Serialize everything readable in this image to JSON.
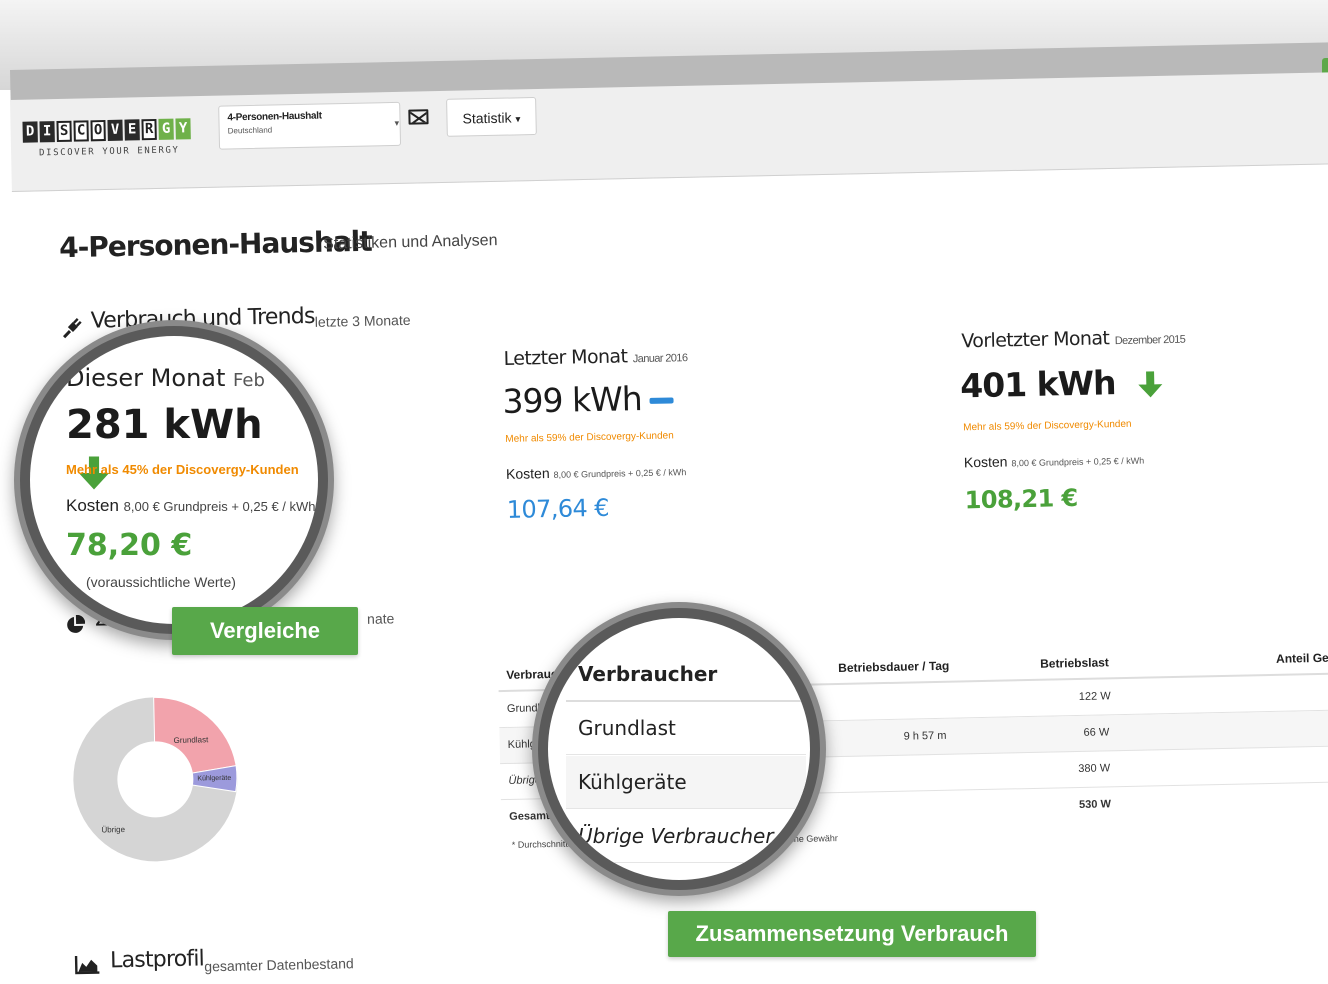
{
  "header": {
    "logo_letters": [
      "D",
      "I",
      "S",
      "C",
      "O",
      "V",
      "E",
      "R",
      "G",
      "Y"
    ],
    "logo_tagline": "DISCOVER YOUR ENERGY",
    "meter_name": "4-Personen-Haushalt",
    "meter_country": "Deutschland",
    "statistik_label": "Statistik",
    "icons": [
      "mail-icon",
      "caret-down-icon"
    ]
  },
  "page": {
    "title": "4-Personen-Haushalt",
    "subtitle": "Statistiken und Analysen"
  },
  "verbrauch": {
    "heading": "Verbrauch und Trends",
    "sub": "letzte 3 Monate",
    "icon": "plug-icon",
    "this_month": {
      "title": "Dieser Monat",
      "month": "Feb",
      "kwh": "281 kWh",
      "compare": "Mehr als 45% der Discovergy-Kunden",
      "cost_label": "Kosten",
      "cost_detail": "8,00 € Grundpreis + 0,25 € / kWh",
      "euro": "78,20 €",
      "note": "(voraussichtliche Werte)",
      "trend": "down"
    },
    "last_month": {
      "title": "Letzter Monat",
      "month": "Januar 2016",
      "kwh": "399 kWh",
      "compare": "Mehr als 59% der Discovergy-Kunden",
      "cost_label": "Kosten",
      "cost_detail": "8,00 € Grundpreis + 0,25 € / kWh",
      "euro": "107,64 €",
      "trend": "neutral"
    },
    "prev_month": {
      "title": "Vorletzter Monat",
      "month": "Dezember 2015",
      "kwh": "401 kWh",
      "compare": "Mehr als 59% der Discovergy-Kunden",
      "cost_label": "Kosten",
      "cost_detail": "8,00 € Grundpreis + 0,25 € / kWh",
      "euro": "108,21 €",
      "trend": "down"
    }
  },
  "zusammensetzung": {
    "heading": "Zusamm",
    "sub": "nate",
    "icon": "pie-chart-icon",
    "donut": [
      {
        "label": "Grundlast",
        "share": 0.23,
        "color": "#f2a3ac"
      },
      {
        "label": "Kühlgeräte",
        "share": 0.05,
        "color": "#9c9adc"
      },
      {
        "label": "Übrige",
        "share": 0.72,
        "color": "#d5d5d5"
      }
    ],
    "table": {
      "headers": [
        "Verbraucher",
        "Betriebsdauer / Tag",
        "Betriebslast",
        "Anteil Ges"
      ],
      "rows": [
        [
          "Grundlast",
          "",
          "122 W"
        ],
        [
          "Kühlgeräte",
          "9 h 57 m",
          "66 W"
        ],
        [
          "Übrige V",
          "",
          "380 W"
        ],
        [
          "Gesamt",
          "",
          "530 W"
        ]
      ],
      "footnote_start": "* Durchschnittsw",
      "footnote_end": "en ohne Gewähr"
    },
    "magnified": [
      "Verbraucher",
      "Grundlast",
      "Kühlgeräte",
      "Übrige Verbraucher",
      "Gesamt"
    ]
  },
  "labels": {
    "vergleiche": "Vergleiche",
    "zusammensetzung": "Zusammensetzung Verbrauch"
  },
  "lastprofil": {
    "heading": "Lastprofil",
    "sub": "gesamter Datenbestand",
    "icon": "area-chart-icon"
  },
  "colors": {
    "green": "#4aa13a",
    "orange": "#f08a00",
    "blue": "#2e8ad8",
    "label_green": "#58a84a"
  }
}
